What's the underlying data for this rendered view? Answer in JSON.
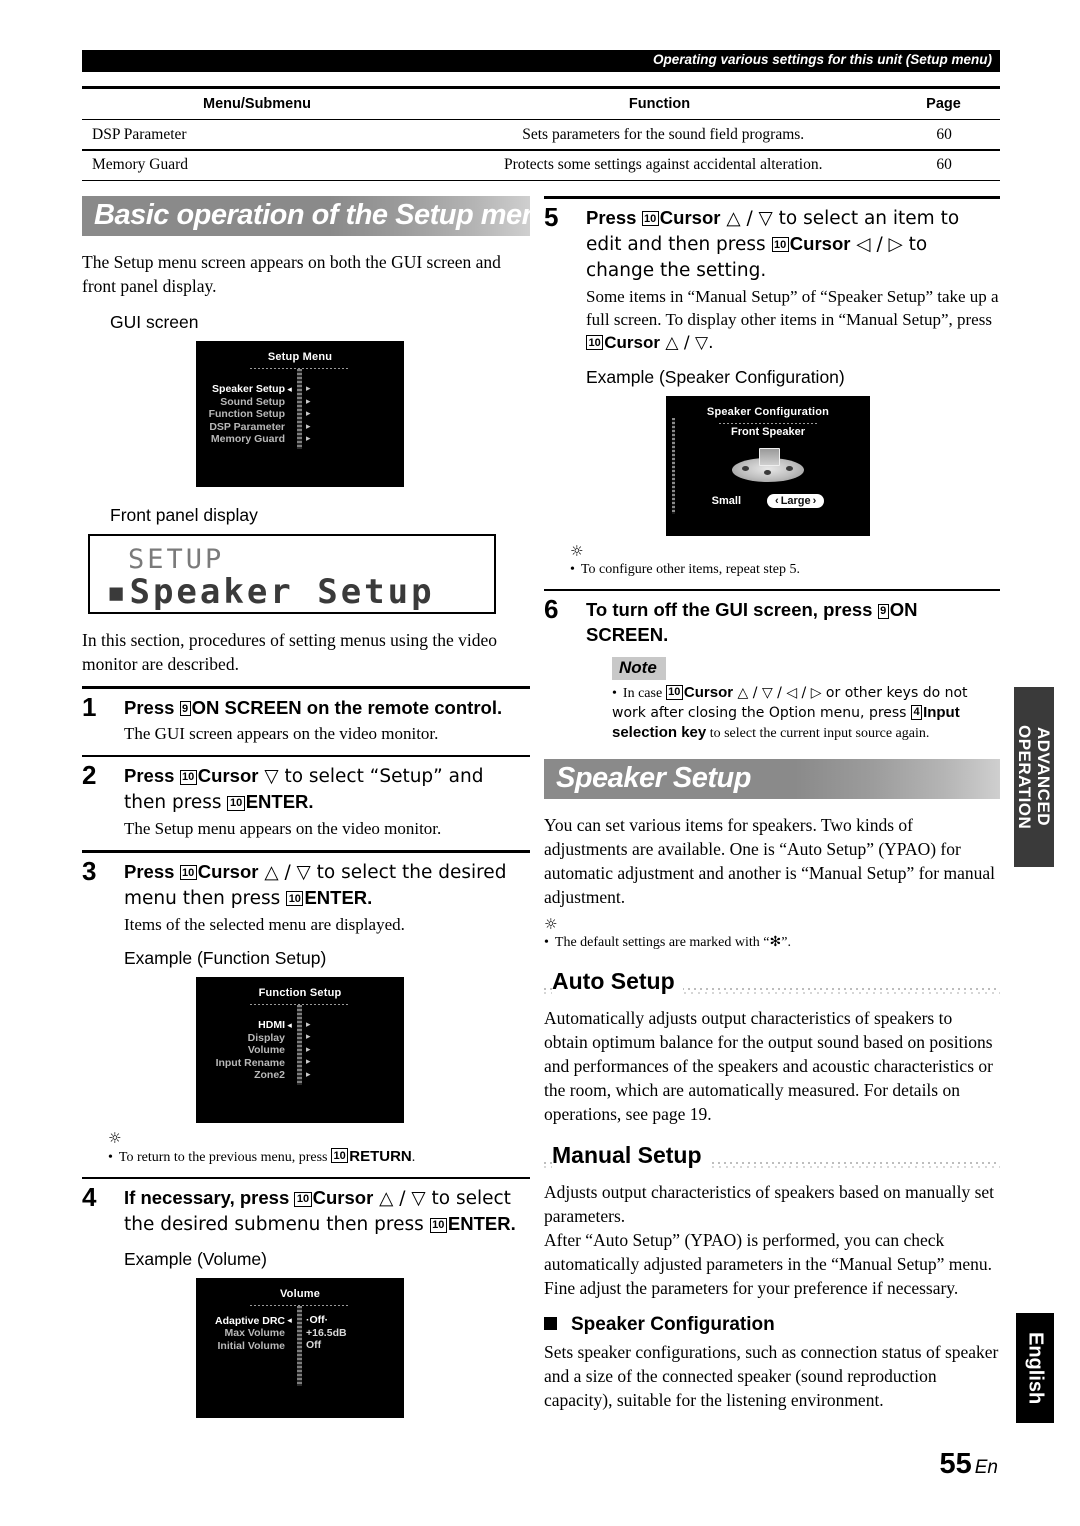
{
  "header": {
    "running_head": "Operating various settings for this unit (Setup menu)"
  },
  "table": {
    "columns": [
      "Menu/Submenu",
      "Function",
      "Page"
    ],
    "rows": [
      {
        "menu": "DSP Parameter",
        "function": "Sets parameters for the sound field programs.",
        "page": "60"
      },
      {
        "menu": "Memory Guard",
        "function": "Protects some settings against accidental alteration.",
        "page": "60"
      }
    ]
  },
  "left_column": {
    "banner": "Basic operation of the Setup menu",
    "intro": "The Setup menu screen appears on both the GUI screen and front panel display.",
    "gui_label": "GUI screen",
    "setup_menu_screen": {
      "title": "Setup Menu",
      "items": [
        {
          "label": "Speaker Setup",
          "selected": true
        },
        {
          "label": "Sound Setup",
          "selected": false
        },
        {
          "label": "Function Setup",
          "selected": false
        },
        {
          "label": "DSP Parameter",
          "selected": false
        },
        {
          "label": "Memory Guard",
          "selected": false
        }
      ]
    },
    "front_panel_label": "Front panel display",
    "front_panel": {
      "line1": "SETUP",
      "line2": "▪Speaker Setup"
    },
    "after_fpd": "In this section, procedures of setting menus using the video monitor are described.",
    "steps": [
      {
        "num": "1",
        "head_pre": "Press ",
        "key": "9",
        "head_bold": "ON SCREEN",
        "head_post": " on the remote control.",
        "body": "The GUI screen appears on the video monitor."
      },
      {
        "num": "2",
        "body": "The Setup menu appears on the video monitor."
      },
      {
        "num": "3",
        "body": "Items of the selected menu are displayed.",
        "example_label": "Example (Function Setup)"
      },
      {
        "num": "4",
        "example_label": "Example (Volume)"
      }
    ],
    "step2_head": {
      "pre": "Press ",
      "key1": "10",
      "bold1": "Cursor",
      "mid": " ▽ to select “Setup” and then press ",
      "key2": "10",
      "bold2": "ENTER",
      "post": "."
    },
    "step3_head": {
      "pre": "Press ",
      "key1": "10",
      "bold1": "Cursor",
      "mid": " △ / ▽ to select the desired menu then press ",
      "key2": "10",
      "bold2": "ENTER",
      "post": "."
    },
    "step4_head": {
      "pre": "If necessary, press ",
      "key1": "10",
      "bold1": "Cursor",
      "mid": " △ / ▽ to select the desired submenu then press ",
      "key2": "10",
      "bold2": "ENTER",
      "post": "."
    },
    "function_setup_screen": {
      "title": "Function Setup",
      "items": [
        {
          "label": "HDMI",
          "selected": true
        },
        {
          "label": "Display",
          "selected": false
        },
        {
          "label": "Volume",
          "selected": false
        },
        {
          "label": "Input Rename",
          "selected": false
        },
        {
          "label": "Zone2",
          "selected": false
        }
      ]
    },
    "tip_return": {
      "pre": "To return to the previous menu, press ",
      "key": "10",
      "bold": "RETURN",
      "post": "."
    },
    "volume_screen": {
      "title": "Volume",
      "items": [
        {
          "label": "Adaptive DRC",
          "value": "·Off·",
          "selected": true
        },
        {
          "label": "Max Volume",
          "value": "+16.5dB",
          "selected": false
        },
        {
          "label": "Initial Volume",
          "value": "Off",
          "selected": false
        }
      ]
    }
  },
  "right_column": {
    "step5": {
      "num": "5",
      "head": {
        "pre": "Press ",
        "key1": "10",
        "bold1": "Cursor",
        "mid": " △ / ▽ to select an item to edit and then press ",
        "key2": "10",
        "bold2": "Cursor",
        "mid2": " ◁ / ▷ to change the setting."
      },
      "body_pre": "Some items in “Manual Setup” of “Speaker Setup” take up a full screen. To display other items in “Manual Setup”, press ",
      "body_key": "10",
      "body_bold": "Cursor",
      "body_post": " △ / ▽.",
      "example_label": "Example (Speaker Configuration)"
    },
    "speaker_config_screen": {
      "title": "Speaker Configuration",
      "subtitle": "Front Speaker",
      "options": [
        {
          "label": "Small",
          "highlighted": false
        },
        {
          "label": "Large",
          "highlighted": true
        }
      ]
    },
    "tip_repeat": "To configure other items, repeat step 5.",
    "step6": {
      "num": "6",
      "head_pre": "To turn off the GUI screen, press ",
      "key": "9",
      "head_bold": "ON SCREEN",
      "head_post": "."
    },
    "note": {
      "badge": "Note",
      "pre": "In case ",
      "key1": "10",
      "bold1": "Cursor",
      "mid": " △ / ▽ / ◁ / ▷ or other keys do not work after closing the Option menu, press ",
      "key2": "4",
      "bold2": "Input selection key",
      "post": " to select the current input source again."
    },
    "banner": "Speaker Setup",
    "speaker_setup_intro": "You can set various items for speakers. Two kinds of adjustments are available. One is “Auto Setup” (YPAO) for automatic adjustment and another is “Manual Setup” for manual adjustment.",
    "tip_default": "The default settings are marked with “✻”.",
    "auto_setup": {
      "heading": "Auto Setup",
      "body": "Automatically adjusts output characteristics of speakers to obtain optimum balance for the output sound based on positions and performances of the speakers and acoustic characteristics or the room, which are automatically measured. For details on operations, see page 19."
    },
    "manual_setup": {
      "heading": "Manual Setup",
      "body1": "Adjusts output characteristics of speakers based on manually set parameters.",
      "body2": "After “Auto Setup” (YPAO) is performed, you can check automatically adjusted parameters in the “Manual Setup” menu. Fine adjust the parameters for your preference if necessary."
    },
    "speaker_configuration": {
      "heading": "Speaker Configuration",
      "body": "Sets speaker configurations, such as connection status of speaker and a size of the connected speaker (sound reproduction capacity), suitable for the listening environment."
    }
  },
  "side_tabs": {
    "advanced": "ADVANCED\nOPERATION",
    "language": "English"
  },
  "footer": {
    "page_number": "55",
    "page_suffix": "En"
  }
}
